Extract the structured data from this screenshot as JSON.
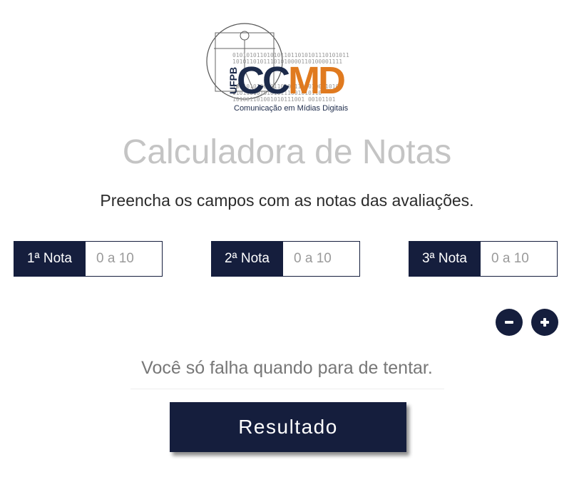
{
  "logo": {
    "text": "CCMD",
    "vertical_text": "UFPB",
    "tagline": "Comunicação em Mídias Digitais",
    "binary_lines": [
      "0101010110101011011010101110101011",
      "10101101011101010000110100001111",
      "010101011100010110101001110101",
      "1011010100101101011101010001010",
      "01011010101010111001010110",
      "101001101001010111001  00101101"
    ],
    "colors": {
      "navy": "#1c2a4a",
      "orange": "#e07a1f"
    }
  },
  "title": "Calculadora de Notas",
  "subtitle": "Preencha os campos com as notas das avaliações.",
  "grades": [
    {
      "label": "1ª Nota",
      "placeholder": "0 a 10",
      "value": ""
    },
    {
      "label": "2ª Nota",
      "placeholder": "0 a 10",
      "value": ""
    },
    {
      "label": "3ª Nota",
      "placeholder": "0 a 10",
      "value": ""
    }
  ],
  "controls": {
    "remove_icon": "minus-icon",
    "add_icon": "plus-icon"
  },
  "quote": "Você só falha quando para de tentar.",
  "result_button": "Resultado",
  "colors": {
    "primary": "#151e3d",
    "title_gray": "#c4c4c4",
    "quote_gray": "#777777"
  }
}
